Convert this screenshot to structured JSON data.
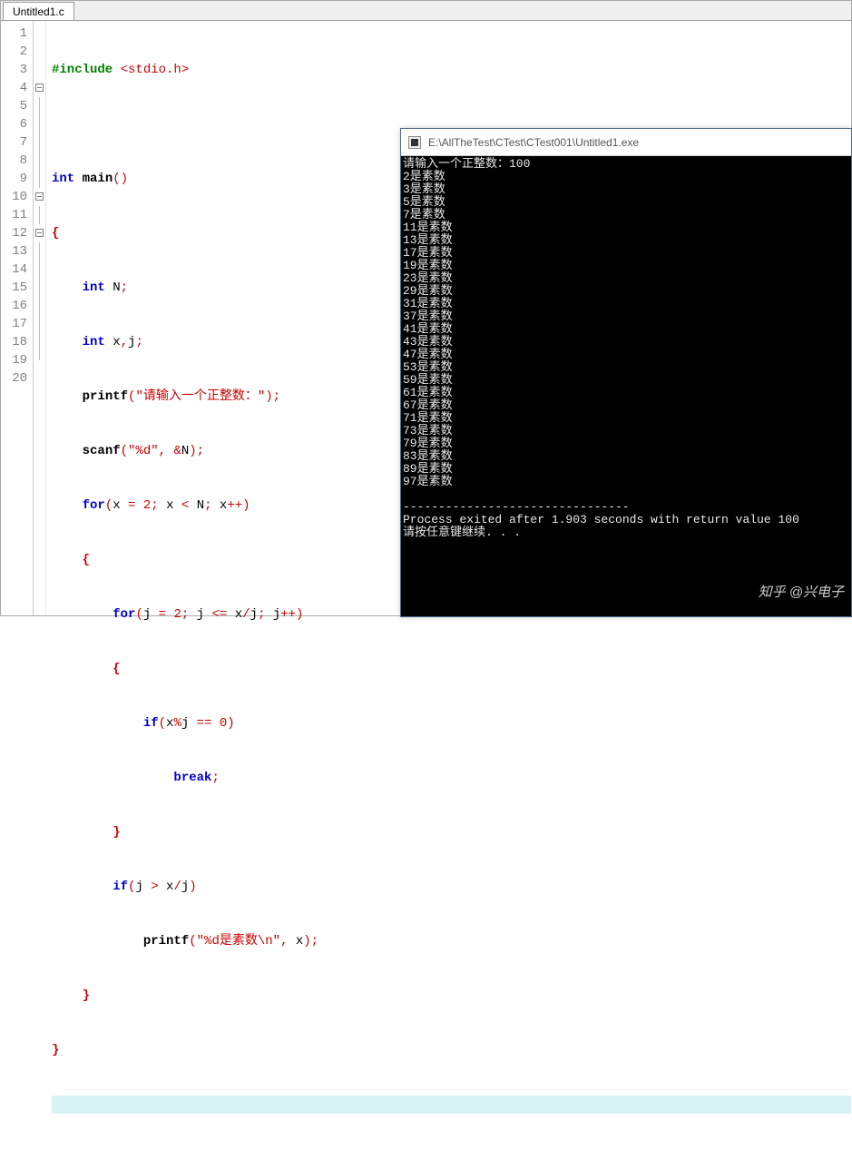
{
  "tab": {
    "label": "Untitled1.c"
  },
  "editor": {
    "line_numbers": [
      "1",
      "2",
      "3",
      "4",
      "5",
      "6",
      "7",
      "8",
      "9",
      "10",
      "11",
      "12",
      "13",
      "14",
      "15",
      "16",
      "17",
      "18",
      "19",
      "20"
    ],
    "lines": {
      "l1_include": "#include",
      "l1_header": " <stdio.h>",
      "l3_int": "int",
      "l3_main": " main",
      "l3_paren": "()",
      "l4_brace": "{",
      "l5_int": "int",
      "l5_rest": " N",
      "l5_semi": ";",
      "l6_int": "int",
      "l6_rest": " x",
      "l6_comma": ",",
      "l6_j": "j",
      "l6_semi": ";",
      "l7_fn": "printf",
      "l7_lp": "(",
      "l7_str": "\"请输入一个正整数：\"",
      "l7_rp": ")",
      "l7_semi": ";",
      "l8_fn": "scanf",
      "l8_lp": "(",
      "l8_str": "\"%d\"",
      "l8_comma": ",",
      "l8_amp": " &",
      "l8_n": "N",
      "l8_rp": ")",
      "l8_semi": ";",
      "l9_for": "for",
      "l9_lp": "(",
      "l9_a": "x ",
      "l9_eq": "=",
      "l9_two": " 2",
      "l9_s1": ";",
      "l9_b": " x ",
      "l9_lt": "<",
      "l9_c": " N",
      "l9_s2": ";",
      "l9_d": " x",
      "l9_pp": "++",
      "l9_rp": ")",
      "l10_brace": "{",
      "l11_for": "for",
      "l11_lp": "(",
      "l11_a": "j ",
      "l11_eq": "=",
      "l11_two": " 2",
      "l11_s1": ";",
      "l11_b": " j ",
      "l11_le": "<=",
      "l11_c": " x",
      "l11_div": "/",
      "l11_j": "j",
      "l11_s2": ";",
      "l11_d": " j",
      "l11_pp": "++",
      "l11_rp": ")",
      "l12_brace": "{",
      "l13_if": "if",
      "l13_lp": "(",
      "l13_x": "x",
      "l13_mod": "%",
      "l13_j": "j ",
      "l13_eq": "==",
      "l13_zero": " 0",
      "l13_rp": ")",
      "l14_break": "break",
      "l14_semi": ";",
      "l15_brace": "}",
      "l16_if": "if",
      "l16_lp": "(",
      "l16_j": "j ",
      "l16_gt": ">",
      "l16_x": " x",
      "l16_div": "/",
      "l16_j2": "j",
      "l16_rp": ")",
      "l17_fn": "printf",
      "l17_lp": "(",
      "l17_str": "\"%d是素数\\n\"",
      "l17_comma": ",",
      "l17_x": " x",
      "l17_rp": ")",
      "l17_semi": ";",
      "l18_brace": "}",
      "l19_brace": "}"
    }
  },
  "console": {
    "title": "E:\\AllTheTest\\CTest\\CTest001\\Untitled1.exe",
    "lines": [
      "请输入一个正整数：100",
      "2是素数",
      "3是素数",
      "5是素数",
      "7是素数",
      "11是素数",
      "13是素数",
      "17是素数",
      "19是素数",
      "23是素数",
      "29是素数",
      "31是素数",
      "37是素数",
      "41是素数",
      "43是素数",
      "47是素数",
      "53是素数",
      "59是素数",
      "61是素数",
      "67是素数",
      "71是素数",
      "73是素数",
      "79是素数",
      "83是素数",
      "89是素数",
      "97是素数",
      "",
      "--------------------------------",
      "Process exited after 1.903 seconds with return value 100",
      "请按任意键继续. . ."
    ]
  },
  "watermark": "知乎 @兴电子"
}
